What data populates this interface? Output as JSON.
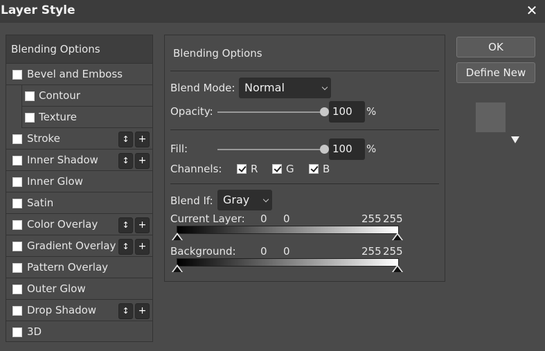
{
  "window": {
    "title": "Layer Style",
    "close_glyph": "✕"
  },
  "sidebar": {
    "header": "Blending Options",
    "items": [
      {
        "label": "Bevel and Emboss",
        "checked": false
      },
      {
        "label": "Contour",
        "checked": false,
        "indent": true
      },
      {
        "label": "Texture",
        "checked": false,
        "indent": true
      },
      {
        "label": "Stroke",
        "checked": false,
        "controls": true
      },
      {
        "label": "Inner Shadow",
        "checked": false,
        "controls": true
      },
      {
        "label": "Inner Glow",
        "checked": false
      },
      {
        "label": "Satin",
        "checked": false
      },
      {
        "label": "Color Overlay",
        "checked": false,
        "controls": true
      },
      {
        "label": "Gradient Overlay",
        "checked": false,
        "controls": true
      },
      {
        "label": "Pattern Overlay",
        "checked": false
      },
      {
        "label": "Outer Glow",
        "checked": false
      },
      {
        "label": "Drop Shadow",
        "checked": false,
        "controls": true
      },
      {
        "label": "3D",
        "checked": false
      }
    ],
    "reorder_glyph": "↕",
    "add_glyph": "+"
  },
  "panel": {
    "title": "Blending Options",
    "blend_mode": {
      "label": "Blend Mode:",
      "value": "Normal"
    },
    "opacity": {
      "label": "Opacity:",
      "value": "100",
      "unit": "%",
      "level": 1.0
    },
    "fill": {
      "label": "Fill:",
      "value": "100",
      "unit": "%",
      "level": 1.0
    },
    "channels": {
      "label": "Channels:",
      "r": "R",
      "g": "G",
      "b": "B"
    },
    "blend_if": {
      "label": "Blend If:",
      "value": "Gray"
    },
    "current_layer": {
      "label": "Current Layer:",
      "low1": "0",
      "low2": "0",
      "high1": "255",
      "high2": "255"
    },
    "background": {
      "label": "Background:",
      "low1": "0",
      "low2": "0",
      "high1": "255",
      "high2": "255"
    }
  },
  "buttons": {
    "ok": "OK",
    "define_new": "Define New"
  },
  "colors": {
    "dialog_bg": "#4a4a4a",
    "titlebar_bg": "#3c3c3c",
    "field_bg": "#2b2b2b"
  }
}
